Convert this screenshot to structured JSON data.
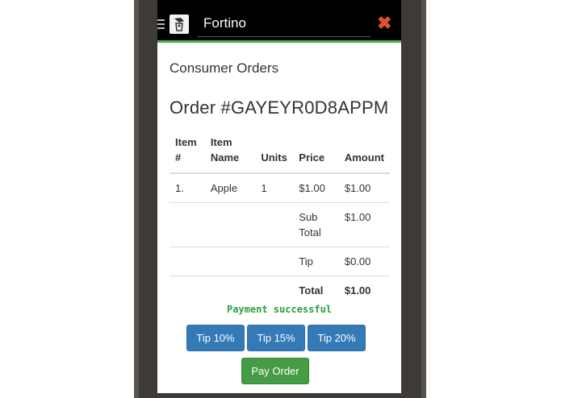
{
  "app": {
    "title": "Fortino",
    "logo_icon": "chef-logo",
    "menu_icon": "hamburger-icon",
    "close_icon": "close-x-icon",
    "accent_color": "#4caf50"
  },
  "page": {
    "section_title": "Consumer Orders",
    "order_title": "Order #GAYEYR0D8APPM"
  },
  "table": {
    "headers": {
      "item_no": "Item #",
      "item_name": "Item Name",
      "units": "Units",
      "price": "Price",
      "amount": "Amount"
    },
    "rows": [
      {
        "item_no": "1.",
        "item_name": "Apple",
        "units": "1",
        "price": "$1.00",
        "amount": "$1.00"
      }
    ],
    "subtotal": {
      "label": "Sub Total",
      "value": "$1.00"
    },
    "tip": {
      "label": "Tip",
      "value": "$0.00"
    },
    "total": {
      "label": "Total",
      "value": "$1.00"
    }
  },
  "status": {
    "message": "Payment successful",
    "color": "#2e9e3e"
  },
  "buttons": {
    "tip10": "Tip 10%",
    "tip15": "Tip 15%",
    "tip20": "Tip 20%",
    "pay": "Pay Order",
    "tip_color": "#337ab7",
    "pay_color": "#449d44"
  }
}
